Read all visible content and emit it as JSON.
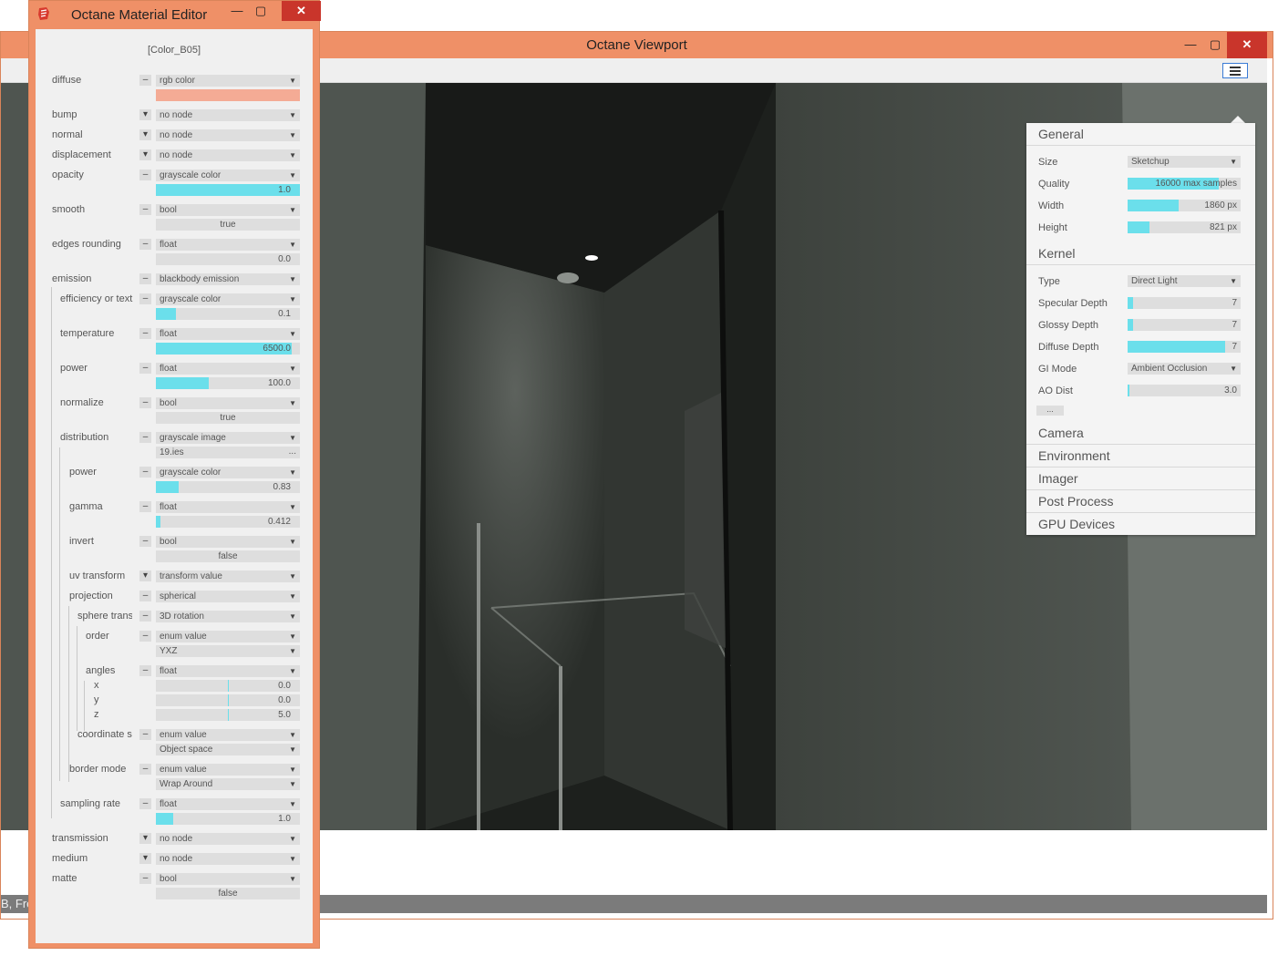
{
  "viewport": {
    "title": "Octane Viewport",
    "status_text": "B, Fre",
    "settings": {
      "general": {
        "title": "General",
        "size_label": "Size",
        "size_value": "Sketchup",
        "quality_label": "Quality",
        "quality_value": "16000 max samples",
        "quality_fraction": 0.81,
        "width_label": "Width",
        "width_value": "1860 px",
        "width_fraction": 0.45,
        "height_label": "Height",
        "height_value": "821 px",
        "height_fraction": 0.19
      },
      "kernel": {
        "title": "Kernel",
        "type_label": "Type",
        "type_value": "Direct Light",
        "specular_label": "Specular Depth",
        "specular_value": "7",
        "specular_fraction": 0.05,
        "glossy_label": "Glossy Depth",
        "glossy_value": "7",
        "glossy_fraction": 0.05,
        "diffuse_label": "Diffuse Depth",
        "diffuse_value": "7",
        "diffuse_fraction": 0.86,
        "gi_label": "GI Mode",
        "gi_value": "Ambient Occlusion",
        "ao_label": "AO Dist",
        "ao_value": "3.0",
        "ao_fraction": 0.02,
        "more_label": "..."
      },
      "sections": [
        "Camera",
        "Environment",
        "Imager",
        "Post Process",
        "GPU Devices"
      ]
    }
  },
  "material_editor": {
    "title": "Octane Material Editor",
    "node_name": "[Color_B05]",
    "colors": {
      "diffuse": "#f4ab95",
      "accent": "#6bdfeb"
    },
    "pins": {
      "diffuse": {
        "label": "diffuse",
        "type": "rgb color"
      },
      "bump": {
        "label": "bump",
        "type": "no node"
      },
      "normal": {
        "label": "normal",
        "type": "no node"
      },
      "displacement": {
        "label": "displacement",
        "type": "no node"
      },
      "opacity": {
        "label": "opacity",
        "type": "grayscale color",
        "value": "1.0",
        "fraction": 1.0
      },
      "smooth": {
        "label": "smooth",
        "type": "bool",
        "value": "true"
      },
      "edges": {
        "label": "edges rounding",
        "type": "float",
        "value": "0.0",
        "fraction": 0.0
      },
      "emission": {
        "label": "emission",
        "type": "blackbody emission"
      },
      "efficiency": {
        "label": "efficiency or text",
        "type": "grayscale color",
        "value": "0.1",
        "fraction": 0.14
      },
      "temperature": {
        "label": "temperature",
        "type": "float",
        "value": "6500.0",
        "fraction": 0.94
      },
      "power": {
        "label": "power",
        "type": "float",
        "value": "100.0",
        "fraction": 0.37
      },
      "normalize": {
        "label": "normalize",
        "type": "bool",
        "value": "true"
      },
      "distribution": {
        "label": "distribution",
        "type": "grayscale image",
        "file": "19.ies",
        "more": "..."
      },
      "dist_power": {
        "label": "power",
        "type": "grayscale color",
        "value": "0.83",
        "fraction": 0.16
      },
      "gamma": {
        "label": "gamma",
        "type": "float",
        "value": "0.412",
        "fraction": 0.03
      },
      "invert": {
        "label": "invert",
        "type": "bool",
        "value": "false"
      },
      "uv_transform": {
        "label": "uv transform",
        "type": "transform value"
      },
      "projection": {
        "label": "projection",
        "type": "spherical"
      },
      "sphere_trans": {
        "label": "sphere trans",
        "type": "3D rotation"
      },
      "order": {
        "label": "order",
        "type": "enum value",
        "value": "YXZ"
      },
      "angles": {
        "label": "angles",
        "type": "float",
        "x_label": "x",
        "x_value": "0.0",
        "y_label": "y",
        "y_value": "0.0",
        "z_label": "z",
        "z_value": "5.0"
      },
      "coordinate": {
        "label": "coordinate sp",
        "type": "enum value",
        "value": "Object space"
      },
      "border_mode": {
        "label": "border mode",
        "type": "enum value",
        "value": "Wrap Around"
      },
      "sampling_rate": {
        "label": "sampling rate",
        "type": "float",
        "value": "1.0",
        "fraction": 0.12
      },
      "transmission": {
        "label": "transmission",
        "type": "no node"
      },
      "medium": {
        "label": "medium",
        "type": "no node"
      },
      "matte": {
        "label": "matte",
        "type": "bool",
        "value": "false"
      }
    }
  }
}
